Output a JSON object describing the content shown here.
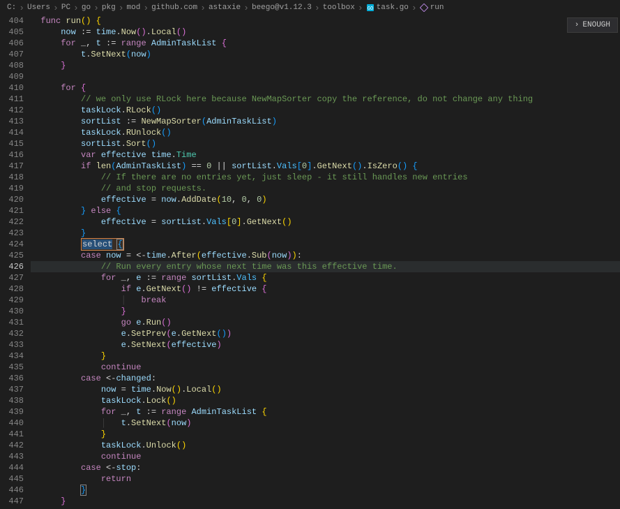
{
  "breadcrumb": [
    {
      "label": "C:"
    },
    {
      "label": "Users"
    },
    {
      "label": "PC"
    },
    {
      "label": "go"
    },
    {
      "label": "pkg"
    },
    {
      "label": "mod"
    },
    {
      "label": "github.com"
    },
    {
      "label": "astaxie"
    },
    {
      "label": "beego@v1.12.3"
    },
    {
      "label": "toolbox"
    },
    {
      "label": "task.go",
      "icon": "go-file-icon",
      "icon_color": "#00add8"
    },
    {
      "label": "run",
      "icon": "function-icon",
      "icon_color": "#b180d7"
    }
  ],
  "enough_button": "ENOUGH",
  "line_start": 404,
  "line_end": 447,
  "highlight_line": 426,
  "selected_word": "select",
  "tokens": {
    "func": "func",
    "run": "run",
    "now": "now",
    "time": "time",
    "Now": "Now",
    "Local": "Local",
    "for": "for",
    "range": "range",
    "AdminTaskList": "AdminTaskList",
    "t": "t",
    "SetNext": "SetNext",
    "cmt1": "// we only use RLock here because NewMapSorter copy the reference, do not change any thing",
    "taskLock": "taskLock",
    "RLock": "RLock",
    "sortList": "sortList",
    "NewMapSorter": "NewMapSorter",
    "RUnlock": "RUnlock",
    "Sort": "Sort",
    "var": "var",
    "effective": "effective",
    "Time": "Time",
    "if": "if",
    "len": "len",
    "Vals": "Vals",
    "zero": "0",
    "GetNext": "GetNext",
    "IsZero": "IsZero",
    "cmt2": "// If there are no entries yet, just sleep - it still handles new entries",
    "cmt3": "// and stop requests.",
    "AddDate": "AddDate",
    "ten": "10",
    "else": "else",
    "select": "select",
    "case": "case",
    "After": "After",
    "Sub": "Sub",
    "cmt4": "// Run every entry whose next time was this effective time.",
    "e": "e",
    "break": "break",
    "go": "go",
    "Run": "Run",
    "SetPrev": "SetPrev",
    "continue": "continue",
    "changed": "changed",
    "Lock": "Lock",
    "Unlock": "Unlock",
    "stop": "stop",
    "return": "return"
  }
}
